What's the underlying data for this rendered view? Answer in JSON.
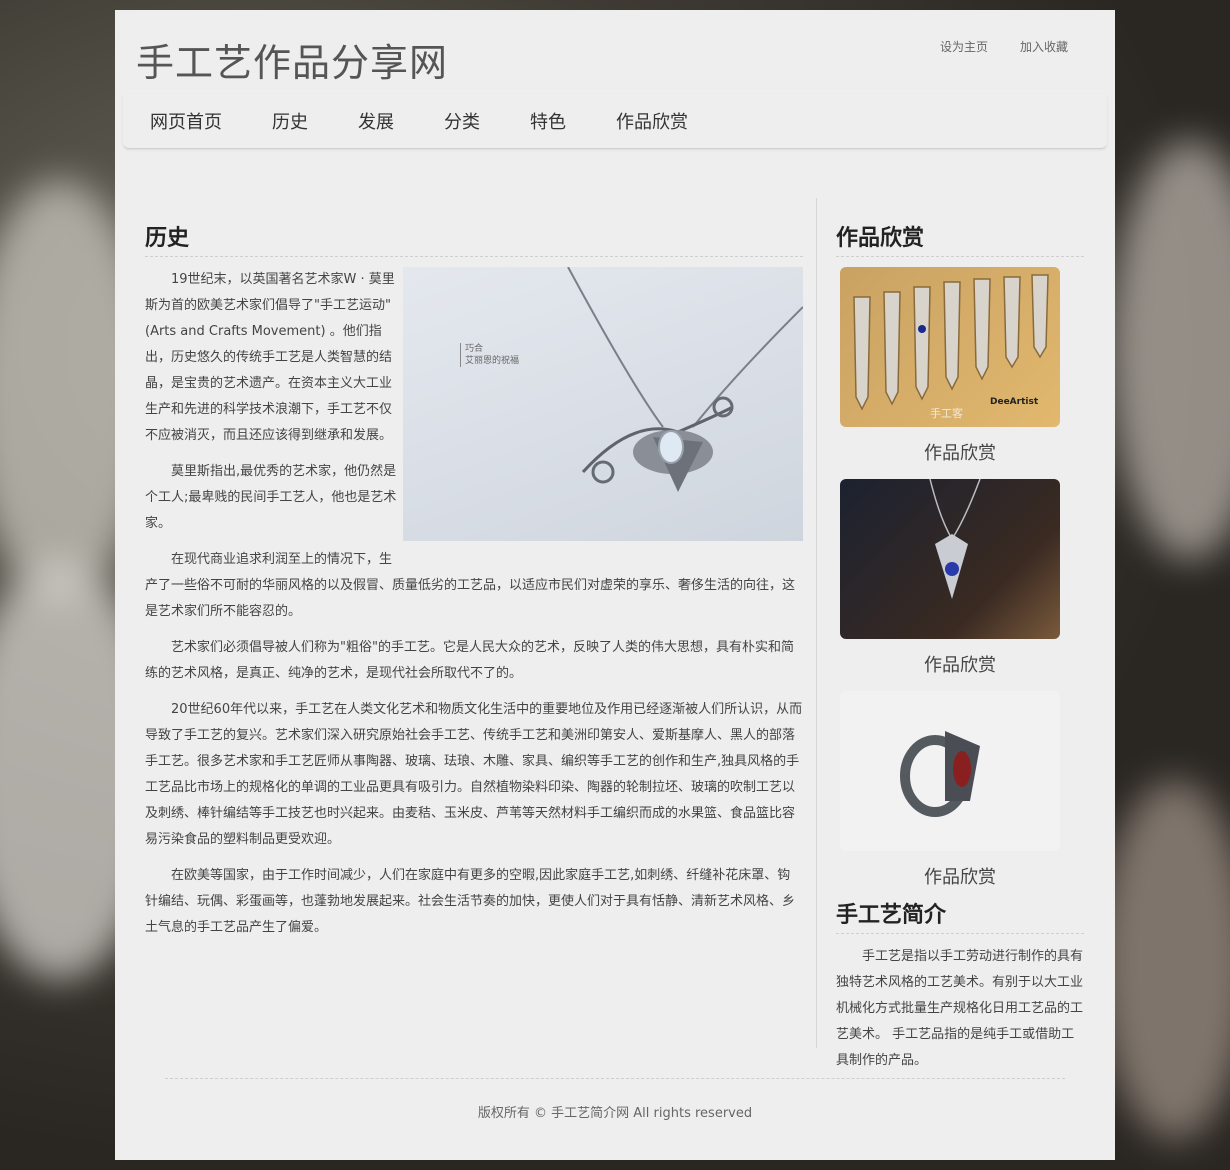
{
  "header": {
    "site_title": "手工艺作品分享网",
    "links": [
      "设为主页",
      "加入收藏"
    ]
  },
  "nav": {
    "items": [
      "网页首页",
      "历史",
      "发展",
      "分类",
      "特色",
      "作品欣赏"
    ]
  },
  "main": {
    "title": "历史",
    "image_label_line1": "巧合",
    "image_label_line2": "艾丽恩的祝福",
    "paragraphs": [
      "19世纪末，以英国著名艺术家W · 莫里斯为首的欧美艺术家们倡导了\"手工艺运动\" (Arts and Crafts Movement) 。他们指出，历史悠久的传统手工艺是人类智慧的结晶，是宝贵的艺术遗产。在资本主义大工业生产和先进的科学技术浪潮下，手工艺不仅不应被消灭，而且还应该得到继承和发展。",
      "莫里斯指出,最优秀的艺术家，他仍然是个工人;最卑贱的民间手工艺人，他也是艺术家。",
      "在现代商业追求利润至上的情况下，生产了一些俗不可耐的华丽风格的以及假冒、质量低劣的工艺品，以适应市民们对虚荣的享乐、奢侈生活的向往，这是艺术家们所不能容忍的。",
      "艺术家们必须倡导被人们称为\"粗俗\"的手工艺。它是人民大众的艺术，反映了人类的伟大思想，具有朴实和简练的艺术风格，是真正、纯净的艺术，是现代社会所取代不了的。",
      "20世纪60年代以来，手工艺在人类文化艺术和物质文化生活中的重要地位及作用已经逐渐被人们所认识，从而导致了手工艺的复兴。艺术家们深入研究原始社会手工艺、传统手工艺和美洲印第安人、爱斯基摩人、黑人的部落手工艺。很多艺术家和手工艺匠师从事陶器、玻璃、珐琅、木雕、家具、编织等手工艺的创作和生产,独具风格的手工艺品比市场上的规格化的单调的工业品更具有吸引力。自然植物染料印染、陶器的轮制拉坯、玻璃的吹制工艺以及刺绣、棒针编结等手工技艺也时兴起来。由麦秸、玉米皮、芦苇等天然材料手工编织而成的水果篮、食品篮比容易污染食品的塑料制品更受欢迎。",
      "在欧美等国家，由于工作时间减少，人们在家庭中有更多的空暇,因此家庭手工艺,如刺绣、纤缝补花床罩、钩针编结、玩偶、彩蛋画等，也蓬勃地发展起来。社会生活节奏的加快，更使人们对于具有恬静、清新艺术风格、乡土气息的手工艺品产生了偏爱。"
    ]
  },
  "sidebar": {
    "gallery_title": "作品欣赏",
    "gallery_captions": [
      "作品欣赏",
      "作品欣赏",
      "作品欣赏"
    ],
    "thumb1_text1": "手工客",
    "thumb1_text2": "DeeArtist",
    "intro_title": "手工艺简介",
    "intro_text": "手工艺是指以手工劳动进行制作的具有独特艺术风格的工艺美术。有别于以大工业机械化方式批量生产规格化日用工艺品的工艺美术。 手工艺品指的是纯手工或借助工具制作的产品。"
  },
  "footer": {
    "copyright": "版权所有 © 手工艺简介网 All rights reserved"
  }
}
